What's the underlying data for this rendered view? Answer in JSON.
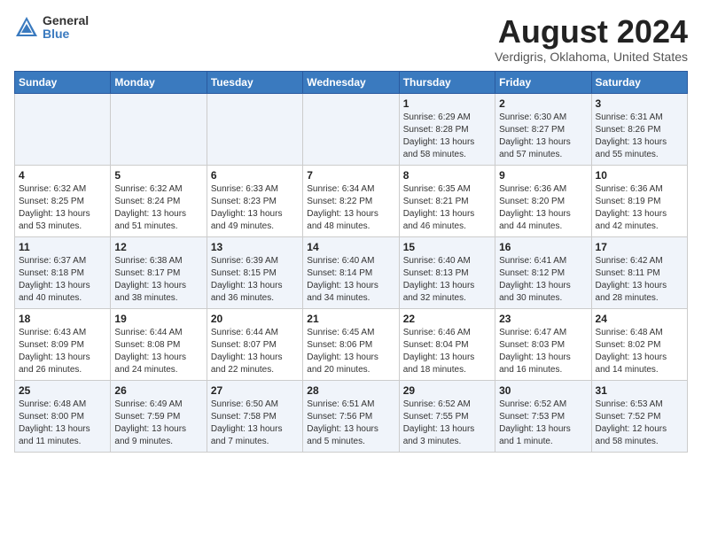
{
  "logo": {
    "general": "General",
    "blue": "Blue"
  },
  "title": "August 2024",
  "subtitle": "Verdigris, Oklahoma, United States",
  "days_of_week": [
    "Sunday",
    "Monday",
    "Tuesday",
    "Wednesday",
    "Thursday",
    "Friday",
    "Saturday"
  ],
  "weeks": [
    [
      {
        "day": "",
        "info": ""
      },
      {
        "day": "",
        "info": ""
      },
      {
        "day": "",
        "info": ""
      },
      {
        "day": "",
        "info": ""
      },
      {
        "day": "1",
        "info": "Sunrise: 6:29 AM\nSunset: 8:28 PM\nDaylight: 13 hours and 58 minutes."
      },
      {
        "day": "2",
        "info": "Sunrise: 6:30 AM\nSunset: 8:27 PM\nDaylight: 13 hours and 57 minutes."
      },
      {
        "day": "3",
        "info": "Sunrise: 6:31 AM\nSunset: 8:26 PM\nDaylight: 13 hours and 55 minutes."
      }
    ],
    [
      {
        "day": "4",
        "info": "Sunrise: 6:32 AM\nSunset: 8:25 PM\nDaylight: 13 hours and 53 minutes."
      },
      {
        "day": "5",
        "info": "Sunrise: 6:32 AM\nSunset: 8:24 PM\nDaylight: 13 hours and 51 minutes."
      },
      {
        "day": "6",
        "info": "Sunrise: 6:33 AM\nSunset: 8:23 PM\nDaylight: 13 hours and 49 minutes."
      },
      {
        "day": "7",
        "info": "Sunrise: 6:34 AM\nSunset: 8:22 PM\nDaylight: 13 hours and 48 minutes."
      },
      {
        "day": "8",
        "info": "Sunrise: 6:35 AM\nSunset: 8:21 PM\nDaylight: 13 hours and 46 minutes."
      },
      {
        "day": "9",
        "info": "Sunrise: 6:36 AM\nSunset: 8:20 PM\nDaylight: 13 hours and 44 minutes."
      },
      {
        "day": "10",
        "info": "Sunrise: 6:36 AM\nSunset: 8:19 PM\nDaylight: 13 hours and 42 minutes."
      }
    ],
    [
      {
        "day": "11",
        "info": "Sunrise: 6:37 AM\nSunset: 8:18 PM\nDaylight: 13 hours and 40 minutes."
      },
      {
        "day": "12",
        "info": "Sunrise: 6:38 AM\nSunset: 8:17 PM\nDaylight: 13 hours and 38 minutes."
      },
      {
        "day": "13",
        "info": "Sunrise: 6:39 AM\nSunset: 8:15 PM\nDaylight: 13 hours and 36 minutes."
      },
      {
        "day": "14",
        "info": "Sunrise: 6:40 AM\nSunset: 8:14 PM\nDaylight: 13 hours and 34 minutes."
      },
      {
        "day": "15",
        "info": "Sunrise: 6:40 AM\nSunset: 8:13 PM\nDaylight: 13 hours and 32 minutes."
      },
      {
        "day": "16",
        "info": "Sunrise: 6:41 AM\nSunset: 8:12 PM\nDaylight: 13 hours and 30 minutes."
      },
      {
        "day": "17",
        "info": "Sunrise: 6:42 AM\nSunset: 8:11 PM\nDaylight: 13 hours and 28 minutes."
      }
    ],
    [
      {
        "day": "18",
        "info": "Sunrise: 6:43 AM\nSunset: 8:09 PM\nDaylight: 13 hours and 26 minutes."
      },
      {
        "day": "19",
        "info": "Sunrise: 6:44 AM\nSunset: 8:08 PM\nDaylight: 13 hours and 24 minutes."
      },
      {
        "day": "20",
        "info": "Sunrise: 6:44 AM\nSunset: 8:07 PM\nDaylight: 13 hours and 22 minutes."
      },
      {
        "day": "21",
        "info": "Sunrise: 6:45 AM\nSunset: 8:06 PM\nDaylight: 13 hours and 20 minutes."
      },
      {
        "day": "22",
        "info": "Sunrise: 6:46 AM\nSunset: 8:04 PM\nDaylight: 13 hours and 18 minutes."
      },
      {
        "day": "23",
        "info": "Sunrise: 6:47 AM\nSunset: 8:03 PM\nDaylight: 13 hours and 16 minutes."
      },
      {
        "day": "24",
        "info": "Sunrise: 6:48 AM\nSunset: 8:02 PM\nDaylight: 13 hours and 14 minutes."
      }
    ],
    [
      {
        "day": "25",
        "info": "Sunrise: 6:48 AM\nSunset: 8:00 PM\nDaylight: 13 hours and 11 minutes."
      },
      {
        "day": "26",
        "info": "Sunrise: 6:49 AM\nSunset: 7:59 PM\nDaylight: 13 hours and 9 minutes."
      },
      {
        "day": "27",
        "info": "Sunrise: 6:50 AM\nSunset: 7:58 PM\nDaylight: 13 hours and 7 minutes."
      },
      {
        "day": "28",
        "info": "Sunrise: 6:51 AM\nSunset: 7:56 PM\nDaylight: 13 hours and 5 minutes."
      },
      {
        "day": "29",
        "info": "Sunrise: 6:52 AM\nSunset: 7:55 PM\nDaylight: 13 hours and 3 minutes."
      },
      {
        "day": "30",
        "info": "Sunrise: 6:52 AM\nSunset: 7:53 PM\nDaylight: 13 hours and 1 minute."
      },
      {
        "day": "31",
        "info": "Sunrise: 6:53 AM\nSunset: 7:52 PM\nDaylight: 12 hours and 58 minutes."
      }
    ]
  ]
}
